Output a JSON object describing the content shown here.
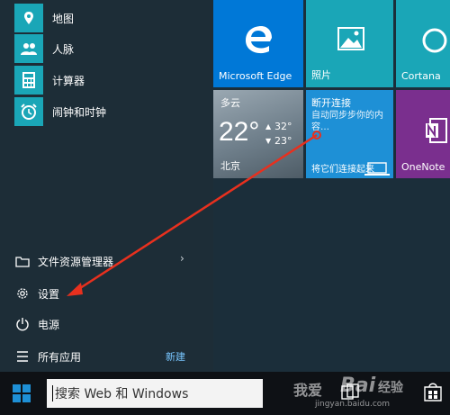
{
  "apps": [
    {
      "label": "地图",
      "icon": "map-icon"
    },
    {
      "label": "人脉",
      "icon": "people-icon"
    },
    {
      "label": "计算器",
      "icon": "calculator-icon"
    },
    {
      "label": "闹钟和时钟",
      "icon": "alarm-clock-icon"
    }
  ],
  "system": {
    "explorer": "文件资源管理器",
    "settings": "设置",
    "power": "电源",
    "all_apps": "所有应用",
    "new_badge": "新建"
  },
  "tiles": {
    "edge": "Microsoft Edge",
    "photos": "照片",
    "cortana": "Cortana",
    "weather": {
      "condition": "多云",
      "temp": "22°",
      "high": "32°",
      "low": "23°",
      "city": "北京"
    },
    "news": {
      "title": "断开连接",
      "body": "自动同步步你的内容…",
      "footer": "将它们连接起来"
    },
    "onenote": "OneNote"
  },
  "taskbar": {
    "search_text": "搜索 Web 和 Windows"
  },
  "watermark": {
    "brand": "Bai",
    "site": "jingyan.baidu.com",
    "jingyan": "经验",
    "woai": "我爱"
  },
  "colors": {
    "accent": "#1aa6b7",
    "edge": "#0078d7",
    "photos": "#1aa6b7",
    "weather": "#8a9aa6",
    "news": "#1e90d6",
    "onenote": "#7a2f8e"
  }
}
